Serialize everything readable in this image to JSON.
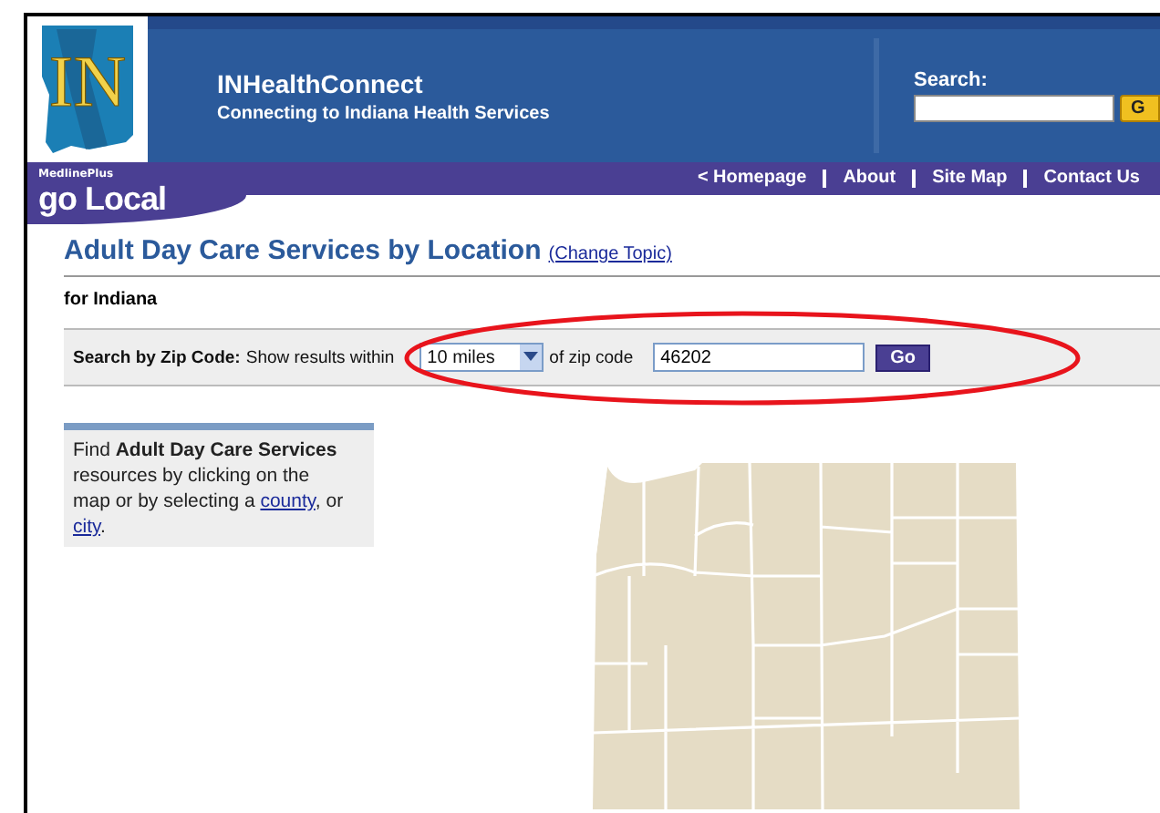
{
  "header": {
    "logo_text": "IN",
    "site_title": "INHealthConnect",
    "tagline": "Connecting to Indiana Health Services",
    "search": {
      "label": "Search:",
      "button": "G"
    }
  },
  "brand": {
    "small": "MedlinePlus",
    "go": "go",
    "local": "Local"
  },
  "nav": [
    "< Homepage",
    "About",
    "Site Map",
    "Contact Us"
  ],
  "page": {
    "title": "Adult Day Care Services by Location",
    "change_topic": "(Change Topic)",
    "subtitle": "for Indiana"
  },
  "zip_search": {
    "label": "Search by Zip Code:",
    "prefix": "Show results within",
    "distance": "10 miles",
    "middle": "of zip code",
    "zip": "46202",
    "button": "Go"
  },
  "info": {
    "parts": [
      {
        "kind": "text",
        "text": "Find **Adult Day Care Services** resources by clicking on the map or by selecting a "
      },
      {
        "kind": "link",
        "text": "county"
      },
      {
        "kind": "text",
        "text": ", or "
      },
      {
        "kind": "link",
        "text": "city"
      },
      {
        "kind": "text",
        "text": "."
      }
    ]
  },
  "map": {
    "kind": "picture"
  },
  "annotation": {
    "kind": "ellipse"
  }
}
